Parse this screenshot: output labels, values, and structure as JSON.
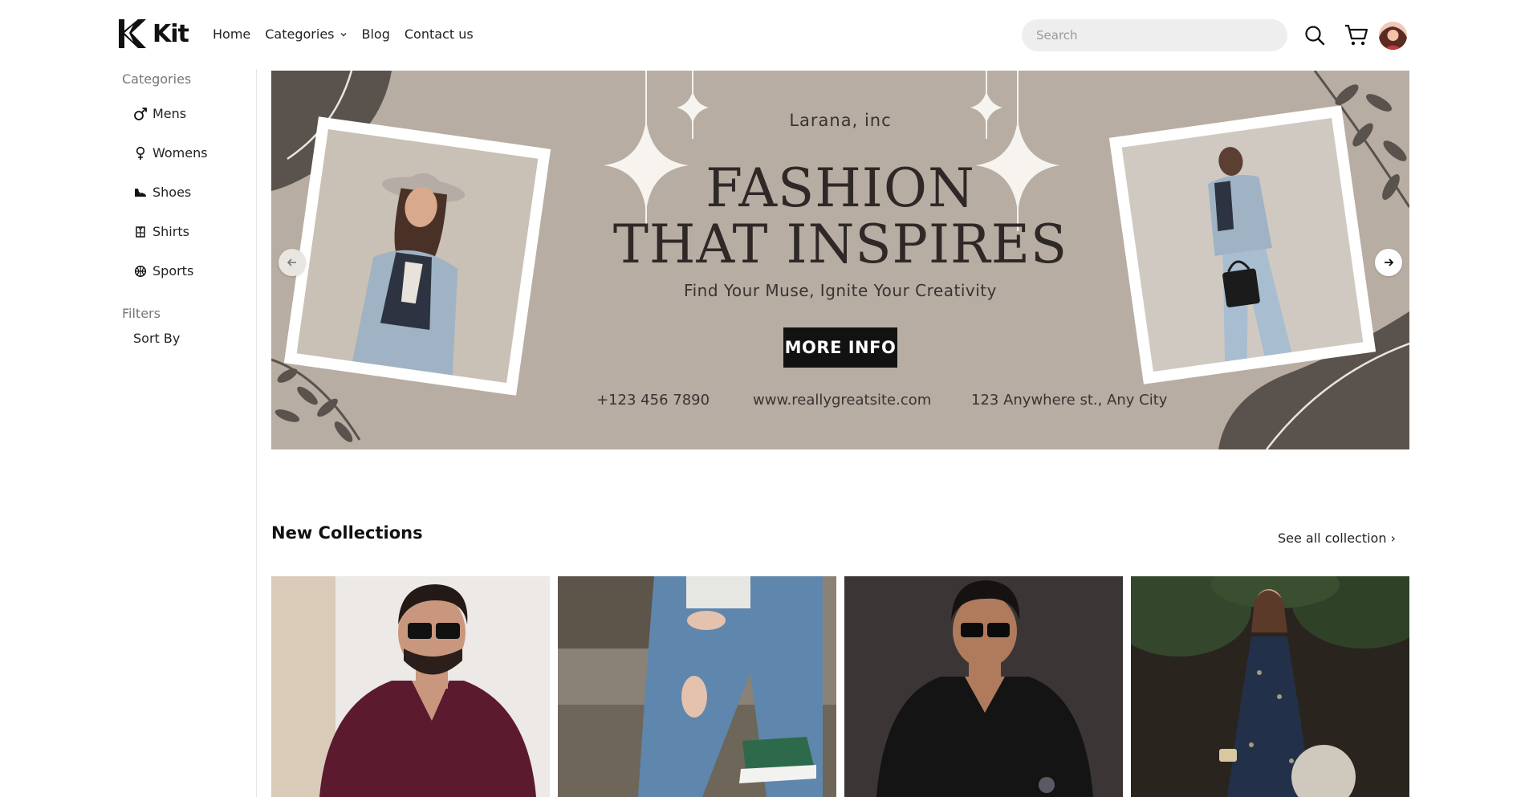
{
  "header": {
    "logo_text": "Kit",
    "nav": [
      {
        "label": "Home"
      },
      {
        "label": "Categories"
      },
      {
        "label": "Blog"
      },
      {
        "label": "Contact us"
      }
    ],
    "search_placeholder": "Search",
    "icons": [
      "search-icon",
      "cart-icon",
      "avatar"
    ]
  },
  "sidebar": {
    "categories_heading": "Categories",
    "categories": [
      {
        "label": "Mens",
        "icon": "male-icon"
      },
      {
        "label": "Womens",
        "icon": "female-icon"
      },
      {
        "label": "Shoes",
        "icon": "shoe-icon"
      },
      {
        "label": "Shirts",
        "icon": "shirt-icon"
      },
      {
        "label": "Sports",
        "icon": "ball-icon"
      }
    ],
    "filters_heading": "Filters",
    "sort_label": "Sort By"
  },
  "banner": {
    "company": "Larana, inc",
    "title_line1": "FASHION",
    "title_line2": "THAT INSPIRES",
    "subtitle": "Find Your Muse, Ignite Your Creativity",
    "button_label": "MORE INFO",
    "phone": "+123 456 7890",
    "website": "www.reallygreatsite.com",
    "address": "123 Anywhere st., Any City",
    "colors": {
      "background": "#b7ada3",
      "dark_shape": "#5a524c",
      "text": "#2f2826"
    }
  },
  "collections": {
    "title": "New Collections",
    "see_all": "See all collection ›",
    "products": [
      {
        "name": "maroon-shirt-man"
      },
      {
        "name": "blue-jeans-sneakers"
      },
      {
        "name": "black-shirt-man"
      },
      {
        "name": "navy-floral-jumpsuit"
      }
    ]
  }
}
